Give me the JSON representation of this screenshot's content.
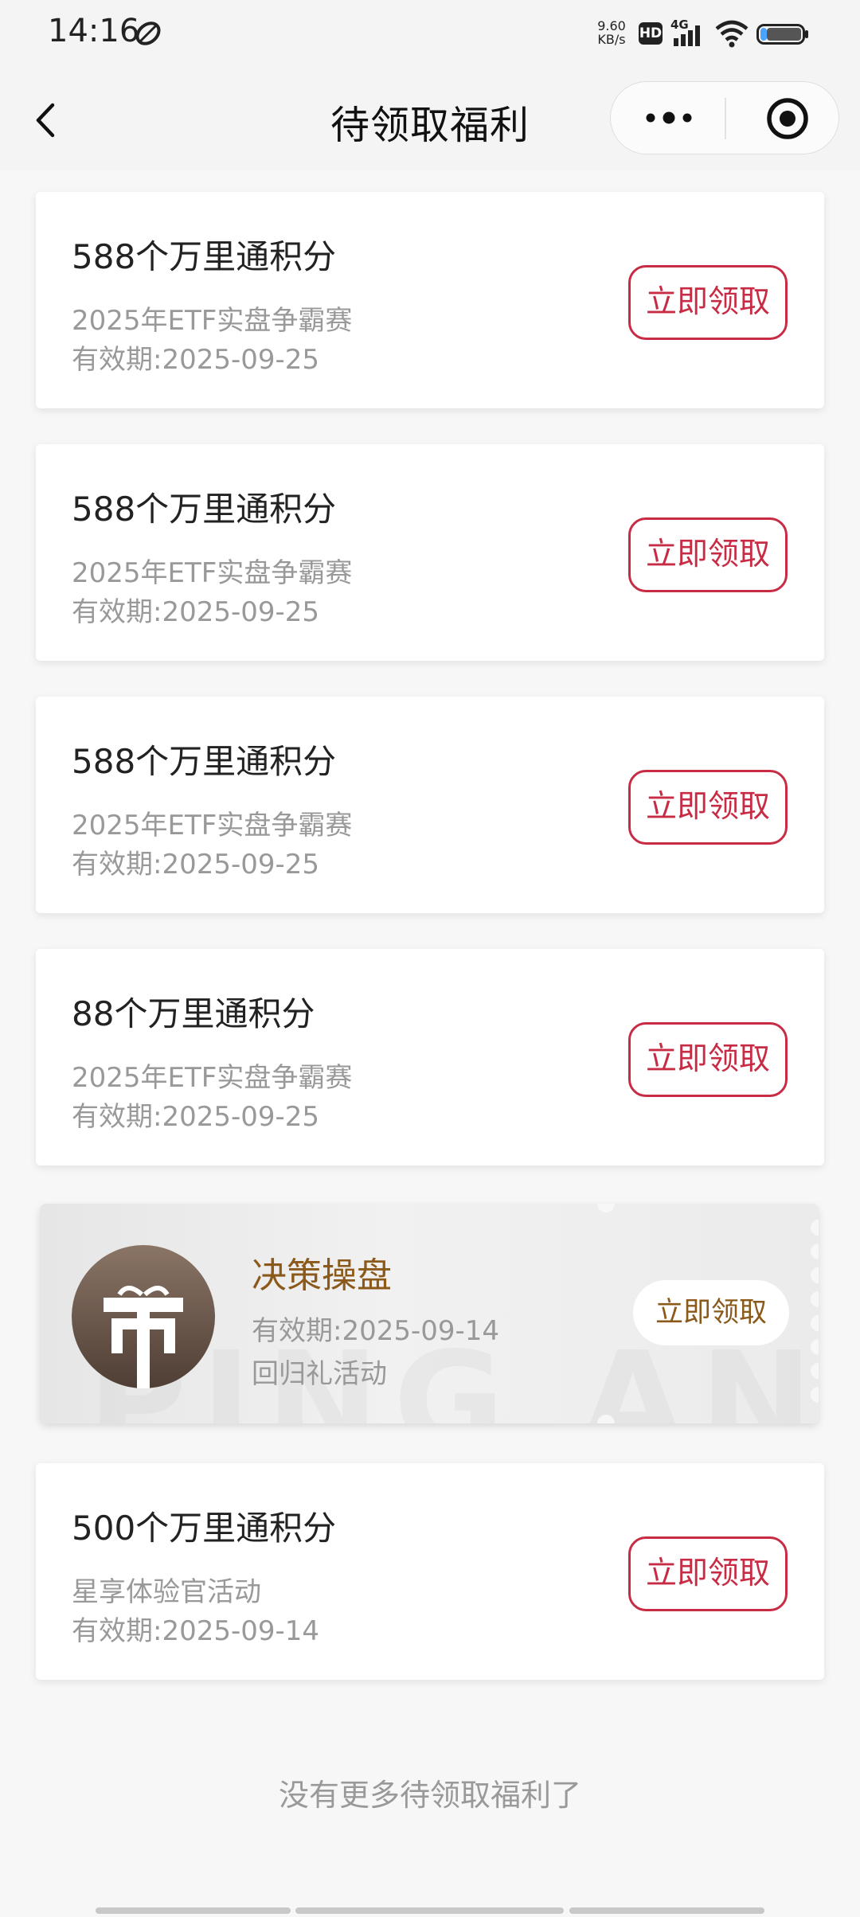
{
  "status_bar": {
    "time": "14:16",
    "net_speed_value": "9.60",
    "net_speed_unit": "KB/s",
    "hd_badge": "HD",
    "network": "4G"
  },
  "nav": {
    "title": "待领取福利"
  },
  "cards": [
    {
      "title": "588个万里通积分",
      "subtitle": "2025年ETF实盘争霸赛",
      "expiry": "有效期:2025-09-25",
      "button": "立即领取"
    },
    {
      "title": "588个万里通积分",
      "subtitle": "2025年ETF实盘争霸赛",
      "expiry": "有效期:2025-09-25",
      "button": "立即领取"
    },
    {
      "title": "588个万里通积分",
      "subtitle": "2025年ETF实盘争霸赛",
      "expiry": "有效期:2025-09-25",
      "button": "立即领取"
    },
    {
      "title": "88个万里通积分",
      "subtitle": "2025年ETF实盘争霸赛",
      "expiry": "有效期:2025-09-25",
      "button": "立即领取"
    }
  ],
  "coupon": {
    "title": "决策操盘",
    "expiry": "有效期:2025-09-14",
    "description": "回归礼活动",
    "button": "立即领取",
    "watermark": "PING AN"
  },
  "last_card": {
    "title": "500个万里通积分",
    "subtitle": "星享体验官活动",
    "expiry": "有效期:2025-09-14",
    "button": "立即领取"
  },
  "footer": {
    "note": "没有更多待领取福利了"
  },
  "colors": {
    "accent_red": "#c82c45",
    "coupon_gold": "#8b5a1b",
    "muted_text": "#999999"
  }
}
